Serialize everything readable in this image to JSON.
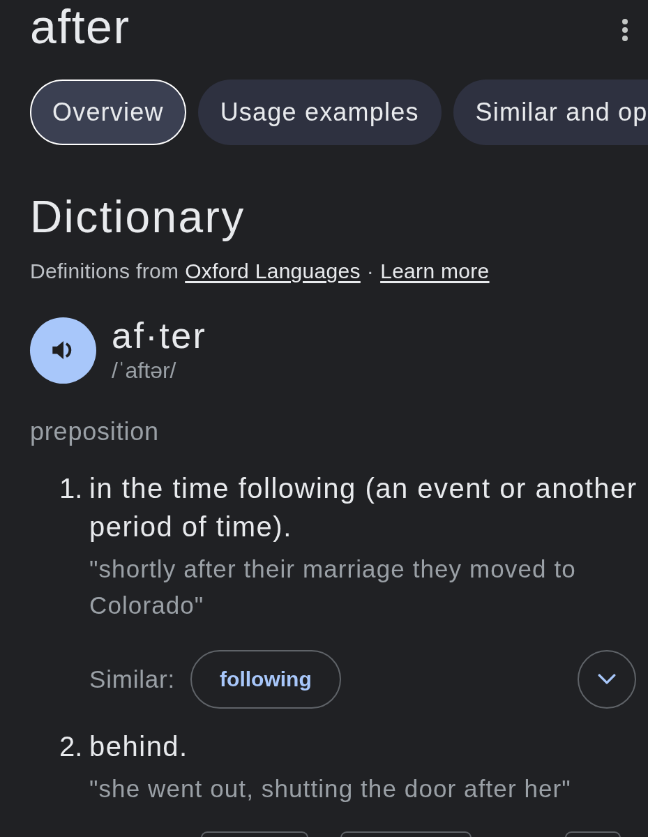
{
  "header": {
    "title": "after"
  },
  "tabs": [
    {
      "label": "Overview",
      "selected": true
    },
    {
      "label": "Usage examples",
      "selected": false
    },
    {
      "label": "Similar and op",
      "selected": false
    }
  ],
  "dictionary": {
    "heading": "Dictionary",
    "source": {
      "prefix": "Definitions from",
      "link": "Oxford Languages",
      "separator": "·",
      "more_link": "Learn more"
    }
  },
  "entry": {
    "headword": "af·ter",
    "pronunciation": "/ˈaftər/"
  },
  "part_of_speech": "preposition",
  "definitions": [
    {
      "number": "1.",
      "text": "in the time following (an event or another period of time).",
      "example": "\"shortly after their marriage they moved to Colorado\"",
      "related": {
        "label": "Similar:",
        "cut_off": false,
        "items": [
          {
            "kind": "chip",
            "label": "following"
          },
          {
            "kind": "expand"
          }
        ]
      }
    },
    {
      "number": "2.",
      "text": "behind.",
      "example": "\"she went out, shutting the door after her\"",
      "related": {
        "cut_off": true,
        "items": [
          {
            "kind": "chip"
          },
          {
            "kind": "chip"
          },
          {
            "kind": "expand"
          }
        ]
      }
    }
  ]
}
